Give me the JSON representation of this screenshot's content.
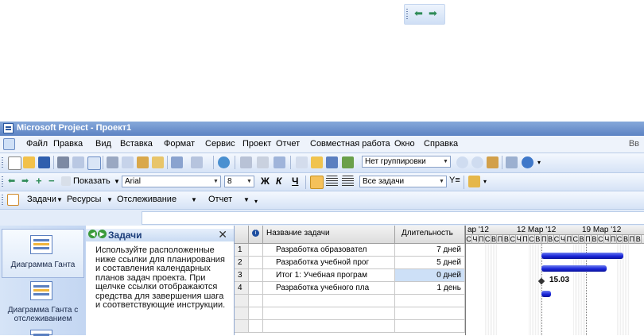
{
  "window_title": "Microsoft Project - Проект1",
  "menu": {
    "items": [
      "Файл",
      "Правка",
      "Вид",
      "Вставка",
      "Формат",
      "Сервис",
      "Проект",
      "Отчет",
      "Совместная работа",
      "Окно",
      "Справка"
    ],
    "help_prompt": "Вв"
  },
  "toolbar1": {
    "grouping": "Нет группировки"
  },
  "toolbar2": {
    "show_label": "Показать",
    "font": "Arial",
    "size": "8",
    "bold": "Ж",
    "italic": "К",
    "underline": "Ч",
    "filter": "Все задачи"
  },
  "toolbar3": {
    "tasks": "Задачи",
    "resources": "Ресурсы",
    "tracking": "Отслеживание",
    "report": "Отчет"
  },
  "viewbar": {
    "items": [
      {
        "label": "Диаграмма Ганта"
      },
      {
        "label": "Диаграмма Ганта с отслеживанием"
      }
    ]
  },
  "taskpane": {
    "title": "Задачи",
    "body": "Используйте расположенные ниже ссылки для планирования и составления календарных планов задач проекта. При щелчке ссылки отображаются средства для завершения шага и соответствующие инструкции."
  },
  "table": {
    "columns": {
      "name": "Название задачи",
      "duration": "Длительность"
    },
    "rows": [
      {
        "id": "1",
        "name": "Разработка образовател",
        "duration": "7 дней"
      },
      {
        "id": "2",
        "name": "Разработка учебной прог",
        "duration": "5 дней"
      },
      {
        "id": "3",
        "name": "Итог 1: Учебная програм",
        "duration": "0 дней"
      },
      {
        "id": "4",
        "name": "Разработка учебного пла",
        "duration": "1 день"
      }
    ]
  },
  "gantt": {
    "weeks": [
      "ар '12",
      "12 Мар '12",
      "19 Мар '12"
    ],
    "days": [
      "С",
      "Ч",
      "П",
      "С",
      "В",
      "П",
      "В",
      "С",
      "Ч",
      "П",
      "С",
      "В",
      "П",
      "В",
      "С",
      "Ч",
      "П",
      "С",
      "В",
      "П",
      "В",
      "С",
      "Ч",
      "П",
      "С",
      "В",
      "П",
      "В"
    ],
    "milestone_label": "15.03"
  },
  "colors": {
    "bar": "#1a26d9",
    "title_bar": "#5c83c3",
    "panel": "#e3ecf9"
  }
}
